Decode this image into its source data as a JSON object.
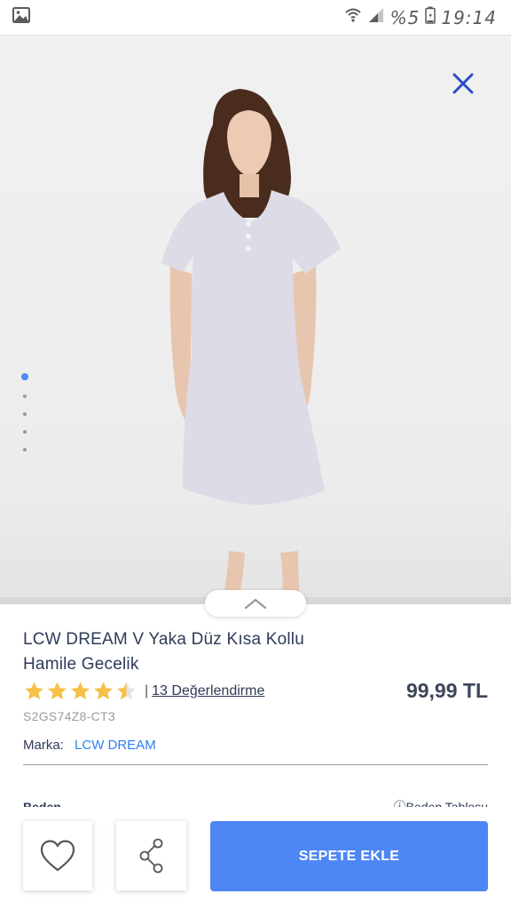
{
  "status_bar": {
    "image_icon": "image-icon",
    "wifi_icon": "wifi-icon",
    "signal_icon": "signal-icon",
    "battery_text": "%5",
    "battery_icon": "battery-icon",
    "time": "19:14"
  },
  "gallery": {
    "close_icon": "close-icon",
    "dot_count": 5,
    "active_index": 0,
    "expand_icon": "chevron-up-icon"
  },
  "product": {
    "title_line1": "LCW DREAM V Yaka Düz Kısa Kollu",
    "title_line2": "Hamile Gecelik",
    "rating": 4.5,
    "reviews_separator": "|",
    "reviews": "13 Değerlendirme",
    "price": "99,99 TL",
    "sku": "S2GS74Z8-CT3",
    "brand_label": "Marka:",
    "brand": "LCW DREAM",
    "next_section_left": "Beden",
    "next_section_right": "ⓘBeden Tablosu"
  },
  "actions": {
    "favorite_icon": "heart-icon",
    "share_icon": "share-icon",
    "add_to_cart": "SEPETE EKLE"
  },
  "colors": {
    "accent": "#4e86f5",
    "brand_link": "#2d7ff0",
    "text_dark": "#2e3a59",
    "star": "#f5c045",
    "close_icon": "#2a4cc8"
  }
}
